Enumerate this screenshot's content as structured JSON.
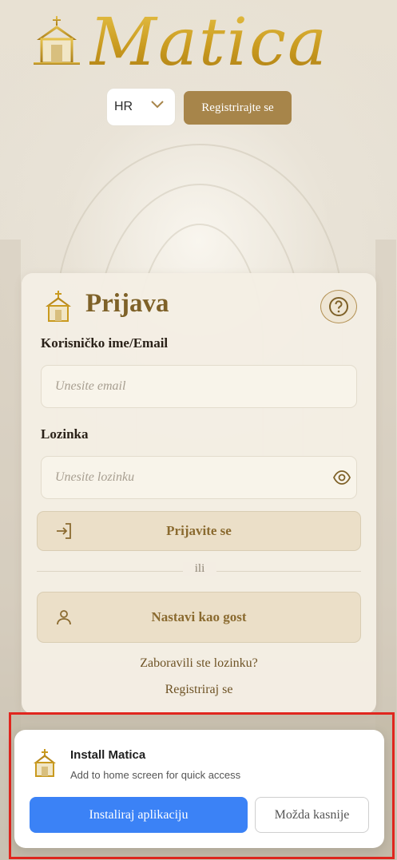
{
  "header": {
    "brand": "Matica",
    "language": "HR",
    "register_button": "Registrirajte se"
  },
  "login": {
    "title": "Prijava",
    "username_label": "Korisničko ime/Email",
    "username_placeholder": "Unesite email",
    "password_label": "Lozinka",
    "password_placeholder": "Unesite lozinku",
    "login_button": "Prijavite se",
    "or_text": "ili",
    "guest_button": "Nastavi kao gost",
    "forgot_link": "Zaboravili ste lozinku?",
    "register_link": "Registriraj se"
  },
  "install_banner": {
    "title": "Install Matica",
    "subtitle": "Add to home screen for quick access",
    "install_button": "Instaliraj aplikaciju",
    "later_button": "Možda kasnije"
  },
  "colors": {
    "accent_gold": "#a7854a",
    "title_brown": "#7e6128",
    "install_blue": "#3b82f6",
    "highlight_red": "#e0261e"
  },
  "icons": {
    "logo": "church-icon",
    "dropdown": "chevron-down-icon",
    "help": "help-circle-icon",
    "password_toggle": "eye-icon",
    "login": "log-in-icon",
    "guest": "user-icon"
  }
}
